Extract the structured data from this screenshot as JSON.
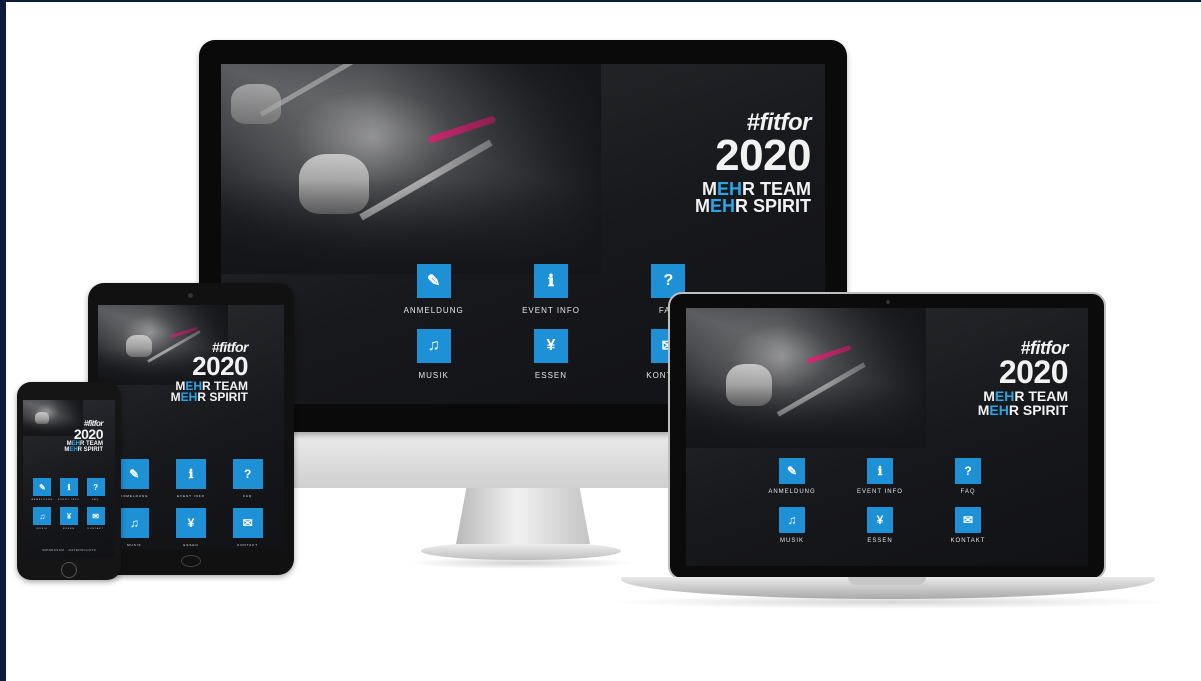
{
  "brand": {
    "hashtag": "#fitfor",
    "year": "2020",
    "tagline1_prefix": "M",
    "tagline1_highlight": "EH",
    "tagline1_rest": "R TEAM",
    "tagline2_prefix": "M",
    "tagline2_highlight": "EH",
    "tagline2_rest": "R SPIRIT"
  },
  "menu": [
    {
      "label": "ANMELDUNG",
      "icon": "edit-icon",
      "glyph": "✎"
    },
    {
      "label": "EVENT INFO",
      "icon": "info-icon",
      "glyph": "ℹ"
    },
    {
      "label": "FAQ",
      "icon": "question-icon",
      "glyph": "?"
    },
    {
      "label": "MUSIK",
      "icon": "music-icon",
      "glyph": "♫"
    },
    {
      "label": "ESSEN",
      "icon": "fork-knife-icon",
      "glyph": "¥"
    },
    {
      "label": "KONTAKT",
      "icon": "envelope-icon",
      "glyph": "✉"
    }
  ],
  "phone_footer": "IMPRESSUM · DATENSCHUTZ",
  "colors": {
    "accent": "#1e90d6",
    "highlight": "#2aa6e8",
    "screen_bg": "#17181c",
    "baton": "#ff2e8a"
  }
}
